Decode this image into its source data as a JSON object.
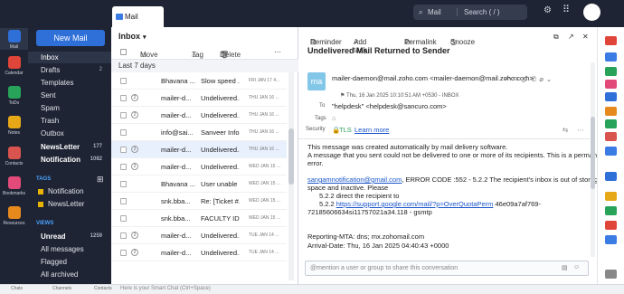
{
  "app": {
    "tab_label": "Mail",
    "search_module": "Mail",
    "search_placeholder": "Search ( / )"
  },
  "rail": [
    {
      "label": "Mail",
      "icon": "mail-icon",
      "color": "#2f6fd8"
    },
    {
      "label": "Calendar",
      "icon": "calendar-icon",
      "color": "#e0453a"
    },
    {
      "label": "ToDo",
      "icon": "todo-icon",
      "color": "#27a35a"
    },
    {
      "label": "Notes",
      "icon": "notes-icon",
      "color": "#e6a817"
    },
    {
      "label": "Contacts",
      "icon": "contacts-icon",
      "color": "#d9534f"
    },
    {
      "label": "Bookmarks",
      "icon": "bookmarks-icon",
      "color": "#e24a7a"
    },
    {
      "label": "Resources",
      "icon": "resources-icon",
      "color": "#e68a1e"
    }
  ],
  "new_mail_label": "New Mail",
  "folders": [
    {
      "label": "Inbox",
      "count": ""
    },
    {
      "label": "Drafts",
      "count": "2"
    },
    {
      "label": "Templates",
      "count": ""
    },
    {
      "label": "Sent",
      "count": ""
    },
    {
      "label": "Spam",
      "count": ""
    },
    {
      "label": "Trash",
      "count": ""
    },
    {
      "label": "Outbox",
      "count": ""
    },
    {
      "label": "NewsLetter",
      "count": "177"
    },
    {
      "label": "Notification",
      "count": "1082"
    }
  ],
  "tags_section": {
    "title": "TAGS",
    "items": [
      "Notification",
      "NewsLetter"
    ]
  },
  "views_section": {
    "title": "VIEWS",
    "items": [
      {
        "label": "Unread",
        "count": "1259"
      },
      {
        "label": "All messages",
        "count": ""
      },
      {
        "label": "Flagged",
        "count": ""
      },
      {
        "label": "All archived",
        "count": ""
      }
    ]
  },
  "list": {
    "title": "Inbox",
    "toolbar": {
      "move": "Move to",
      "tag": "Tag as",
      "delete": "Delete"
    },
    "group_label": "Last 7 days",
    "rows": [
      {
        "thread": "",
        "sender": "Bhavana ...",
        "subject": "Slow speed ...",
        "date": "FRI JAN 17 4..."
      },
      {
        "thread": "2",
        "sender": "mailer-d...",
        "subject": "Undelivered...",
        "date": "THU JAN 16 ..."
      },
      {
        "thread": "2",
        "sender": "mailer-d...",
        "subject": "Undelivered...",
        "date": "THU JAN 16 ..."
      },
      {
        "thread": "",
        "sender": "info@sai...",
        "subject": "Sanveer Info...",
        "date": "THU JAN 16 ..."
      },
      {
        "thread": "2",
        "sender": "mailer-d...",
        "subject": "Undelivered...",
        "date": "THU JAN 16 ..."
      },
      {
        "thread": "2",
        "sender": "mailer-d...",
        "subject": "Undelivered...",
        "date": "WED JAN 15 ..."
      },
      {
        "thread": "",
        "sender": "Bhavana ...",
        "subject": "User unable ...",
        "date": "WED JAN 15 ..."
      },
      {
        "thread": "",
        "sender": "snk.bba...",
        "subject": "Re: [Ticket #...",
        "date": "WED JAN 15 ..."
      },
      {
        "thread": "",
        "sender": "snk.bba...",
        "subject": "FACULTY ID...",
        "date": "WED JAN 15 ..."
      },
      {
        "thread": "2",
        "sender": "mailer-d...",
        "subject": "Undelivered...",
        "date": "TUE JAN 14 ..."
      },
      {
        "thread": "2",
        "sender": "mailer-d...",
        "subject": "Undelivered...",
        "date": "TUE JAN 14 ..."
      }
    ]
  },
  "reader": {
    "toolbar": {
      "reminder": "Reminder",
      "add_task": "Add task",
      "permalink": "Permalink",
      "snooze": "Snooze"
    },
    "subject": "Undelivered Mail Returned to Sender",
    "avatar_initials": "ma",
    "from": "mailer-daemon@mail.zoho.com <mailer-daemon@mail.zoho.com>",
    "meta": "Thu, 16 Jan 2025 10:10:51 AM +0530  -  INBOX",
    "to_label": "To",
    "to": "\"helpdesk\" <helpdesk@sancuro.com>",
    "tags_label": "Tags",
    "security_label": "Security",
    "tls": "TLS",
    "learn_more": "Learn more",
    "body": {
      "p1": "This message was created automatically by mail delivery software.",
      "p2": "A message that you sent could not be delivered to one or more of its recipients. This is a permanent",
      "p3": "error.",
      "addr": "sangamnotification@gmail.com",
      "err": ", ERROR CODE :552 - 5.2.2 The recipient's inbox is out of storage",
      "err2": "space and inactive. Please",
      "direct": "5.2.2 direct the recipient to",
      "prefix": "5.2.2 ",
      "url": "https://support.google.com/mail/?p=OverQuotaPerm",
      "id": " 46e09a7af769-",
      "id2": "72185606634si11757021a34.118 - gsmtp",
      "mta": "Reporting-MTA: dns; mx.zohomail.com",
      "arrival": "Arrival-Date: Thu, 16 Jan 2025 04:40:43 +0000"
    },
    "compose_placeholder": "@mention a user or group to share this conversation"
  },
  "bottom": {
    "items": [
      "Chats",
      "Channels",
      "Contacts"
    ],
    "chat_placeholder": "Here is your Smart Chat (Ctrl+Space)"
  }
}
